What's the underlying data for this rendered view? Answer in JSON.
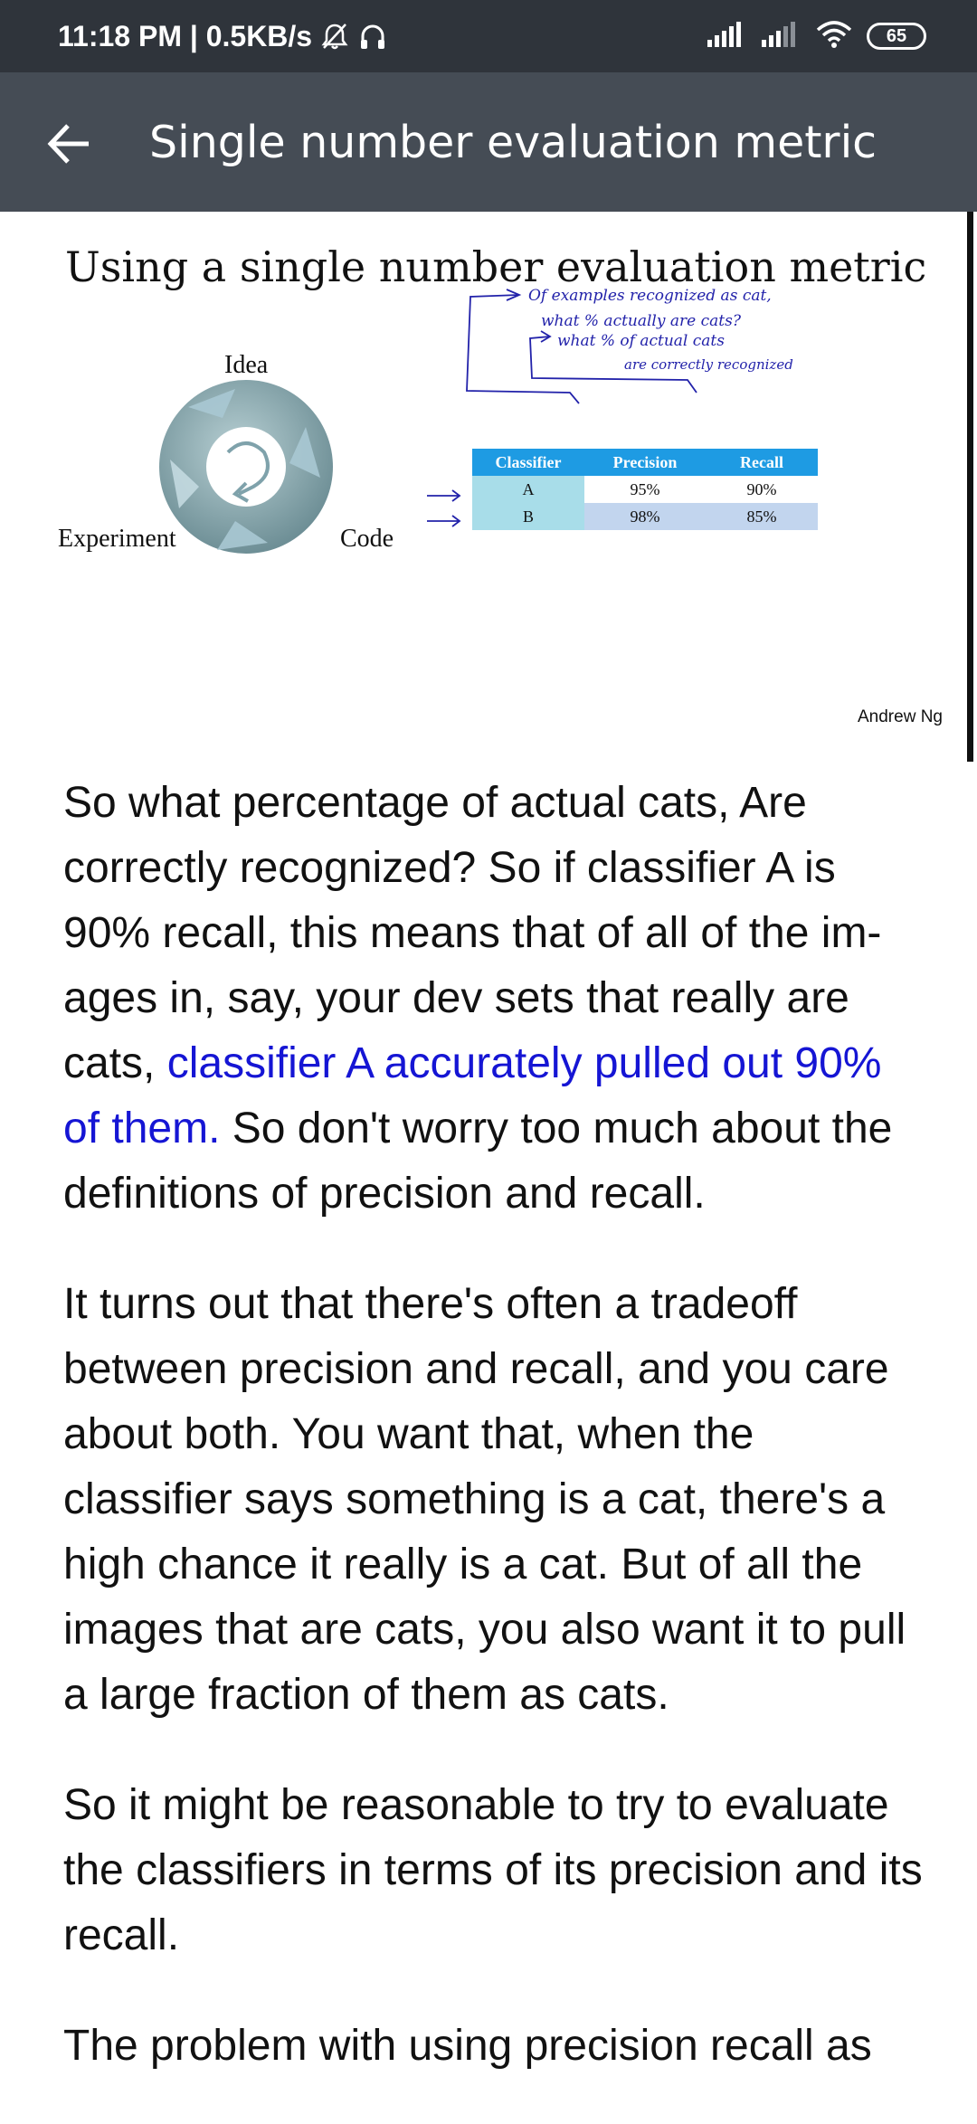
{
  "status_bar": {
    "time_speed": "11:18 PM | 0.5KB/s",
    "battery": "65",
    "icons": [
      "mute-icon",
      "headset-icon",
      "signal-icon",
      "signal-icon",
      "wifi-icon",
      "battery-icon"
    ]
  },
  "app_bar": {
    "title": "Single number evaluation metric",
    "back_icon": "arrow-left-icon"
  },
  "slide": {
    "title": "Using a single number evaluation metric",
    "cycle_labels": {
      "idea": "Idea",
      "experiment": "Experiment",
      "code": "Code"
    },
    "table": {
      "headers": [
        "Classifier",
        "Precision",
        "Recall"
      ],
      "rows": [
        {
          "classifier": "A",
          "precision": "95%",
          "recall": "90%"
        },
        {
          "classifier": "B",
          "precision": "98%",
          "recall": "85%"
        }
      ]
    },
    "notes": {
      "line1": "Of examples recognized as cat,",
      "line2": "what % actually are cats?",
      "line3": "what % of actual cats",
      "line4": "are correctly recognized"
    },
    "author": "Andrew Ng",
    "colors": {
      "table_header": "#1e9be3",
      "first_col": "#a8dde9",
      "row_b": "#c2d5ee"
    }
  },
  "article": {
    "p1_before": "So what percentage of actual cats, Are correctly recognized? So if classifier A is 90% recall, this means that of all of the im-ages in, say, your dev sets that really are cats, ",
    "p1_highlight": "classifier A accurately pulled out 90% of them.",
    "p1_after": " So don't worry too much about the definitions of precision and recall.",
    "p2": "It turns out that there's often a tradeoff between precision and recall, and you care about both. You want that, when the classifier says something is a cat, there's a high chance it really is a cat. But of all the images that are cats, you also want it to pull a large fraction of them as cats.",
    "p3": "So it might be reasonable to try to evaluate the classifiers in terms of its precision and its recall.",
    "p4": "The problem with using precision recall as"
  },
  "highlight_color": "#1515d4"
}
